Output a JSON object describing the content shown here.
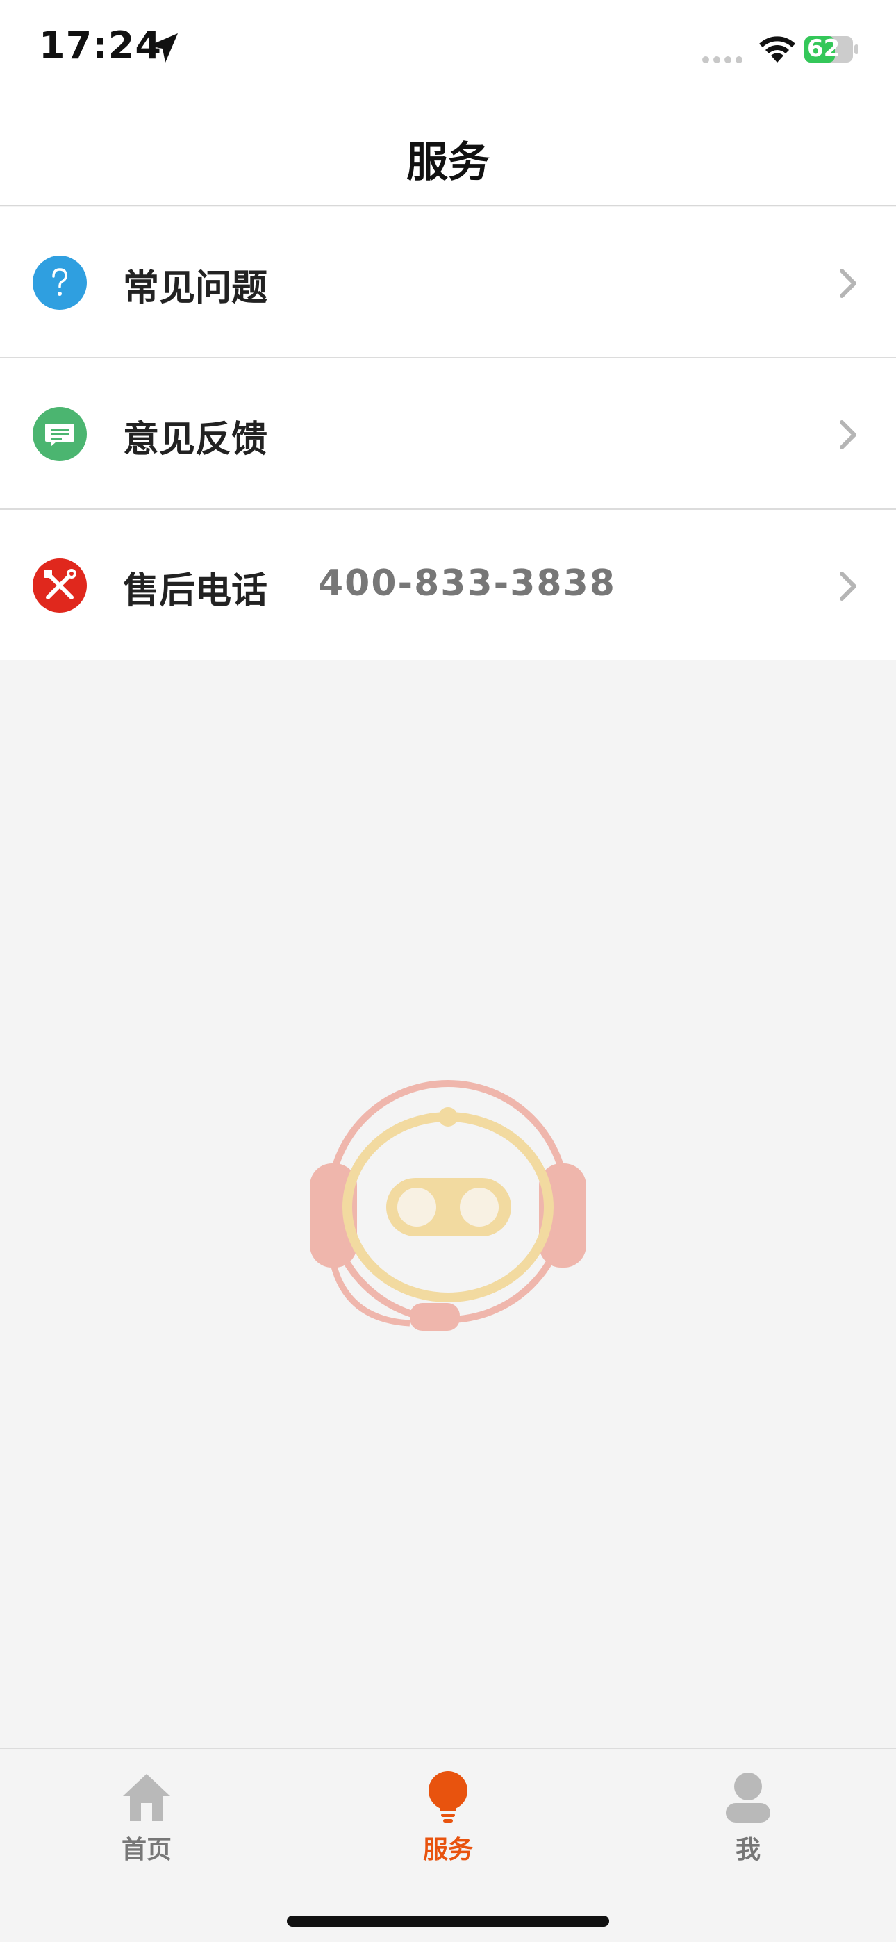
{
  "status_bar": {
    "time": "17:24",
    "battery": "62",
    "location_icon": "location-arrow-icon",
    "wifi_icon": "wifi-icon",
    "battery_icon": "battery-charging-icon"
  },
  "header": {
    "title": "服务"
  },
  "list": {
    "items": [
      {
        "label": "常见问题",
        "value": "",
        "icon": "question-icon",
        "icon_color": "#2f9fe0"
      },
      {
        "label": "意见反馈",
        "value": "",
        "icon": "feedback-icon",
        "icon_color": "#4bb570"
      },
      {
        "label": "售后电话",
        "value": "400-833-3838",
        "icon": "tools-icon",
        "icon_color": "#e0281d"
      }
    ]
  },
  "illustration": {
    "icon": "support-robot-icon"
  },
  "tab_bar": {
    "tabs": [
      {
        "label": "首页",
        "icon": "home-icon",
        "active": false
      },
      {
        "label": "服务",
        "icon": "lightbulb-icon",
        "active": true
      },
      {
        "label": "我",
        "icon": "user-icon",
        "active": false
      }
    ],
    "active_color": "#e8530e",
    "inactive_color": "#b9b9b9"
  }
}
